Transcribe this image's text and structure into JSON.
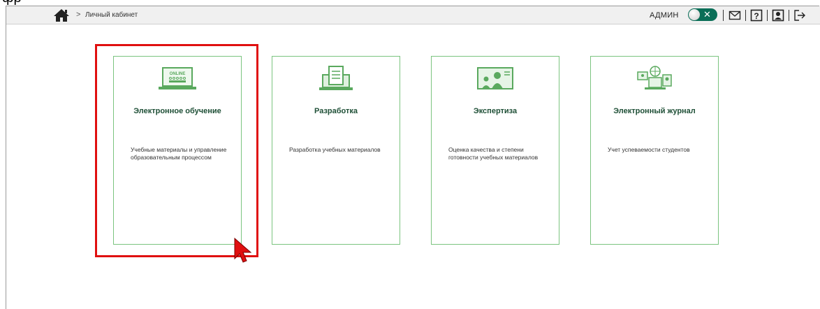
{
  "top_fragment": "фр",
  "breadcrumb": {
    "separator": ">",
    "current": "Личный кабинет"
  },
  "header": {
    "user_label": "АДМИН",
    "toggle_symbol": "✕"
  },
  "cards": [
    {
      "title": "Электронное обучение",
      "description": "Учебные материалы и управление образовательным процессом",
      "icon_text": "ONLINE"
    },
    {
      "title": "Разработка",
      "description": "Разработка учебных материалов"
    },
    {
      "title": "Экспертиза",
      "description": "Оценка качества и степени готовности учебных материалов"
    },
    {
      "title": "Электронный журнал",
      "description": "Учет успеваемости студентов"
    }
  ],
  "colors": {
    "accent": "#0a6e57",
    "card_border": "#7bc47f",
    "highlight": "#e01010"
  },
  "icons": [
    "home-icon",
    "mail-icon",
    "help-icon",
    "profile-icon",
    "logout-icon"
  ]
}
